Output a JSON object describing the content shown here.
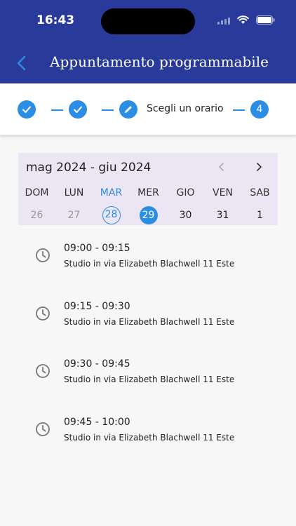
{
  "status_bar": {
    "time": "16:43"
  },
  "header": {
    "title": "Appuntamento programmabile"
  },
  "stepper": {
    "current_label": "Scegli un orario",
    "last_step": "4"
  },
  "calendar": {
    "title": "mag 2024 - giu 2024",
    "weekdays": [
      "DOM",
      "LUN",
      "MAR",
      "MER",
      "GIO",
      "VEN",
      "SAB"
    ],
    "days": [
      "26",
      "27",
      "28",
      "29",
      "30",
      "31",
      "1"
    ],
    "today_index": 2,
    "selected_index": 3
  },
  "slots": [
    {
      "time": "09:00 - 09:15",
      "location": "Studio in via Elizabeth Blachwell 11 Este"
    },
    {
      "time": "09:15 - 09:30",
      "location": "Studio in via Elizabeth Blachwell 11 Este"
    },
    {
      "time": "09:30 - 09:45",
      "location": "Studio in via Elizabeth Blachwell 11 Este"
    },
    {
      "time": "09:45 - 10:00",
      "location": "Studio in via Elizabeth Blachwell 11 Este"
    }
  ],
  "colors": {
    "header": "#2a3a9a",
    "accent": "#2b8de3",
    "calendar_bg": "#ece6f4"
  }
}
